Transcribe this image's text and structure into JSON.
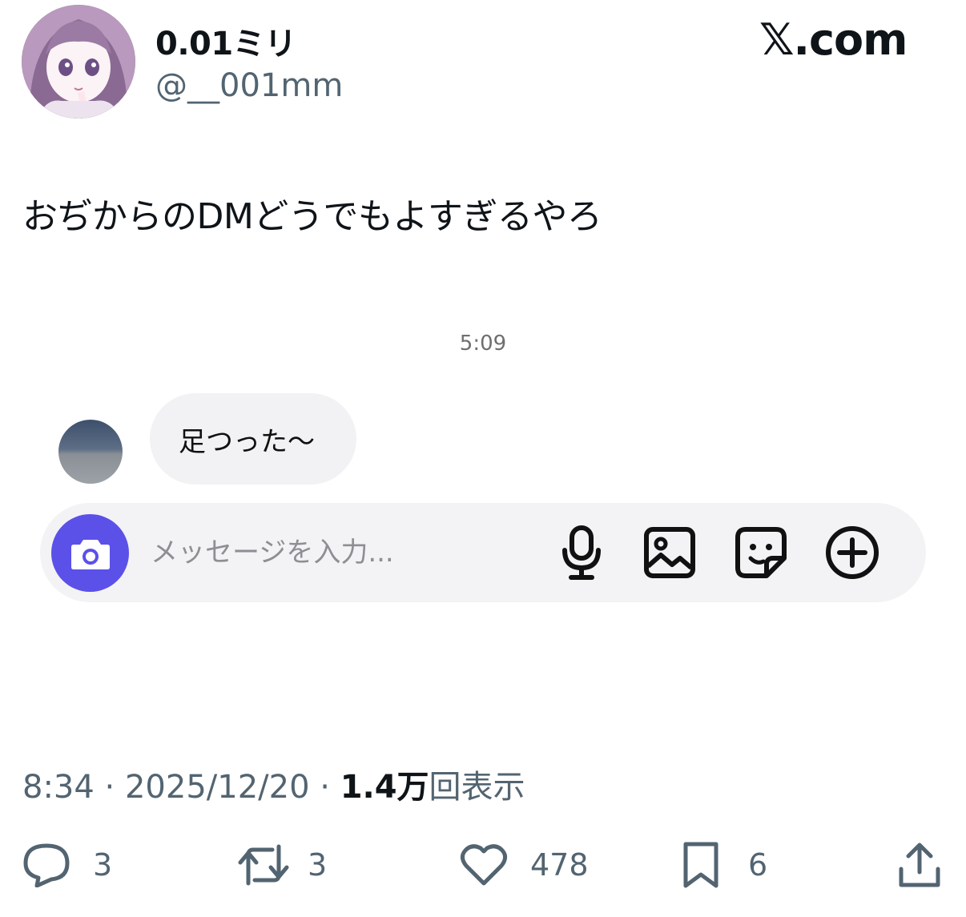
{
  "author": {
    "display_name": "0.01ミリ",
    "handle": "@__001mm"
  },
  "brand": {
    "logo_text": "𝕏.com"
  },
  "tweet": {
    "text": "おぢからのDMどうでもよすぎるやろ"
  },
  "dm_screenshot": {
    "timestamp": "5:09",
    "message": "足つった〜",
    "composer": {
      "placeholder": "メッセージを入力...",
      "accent_color": "#5b51e8"
    }
  },
  "meta": {
    "time": "8:34",
    "date": "2025/12/20",
    "separator": "·",
    "views_count": "1.4万",
    "views_label": "回表示"
  },
  "actions": {
    "replies": "3",
    "reposts": "3",
    "likes": "478",
    "bookmarks": "6"
  },
  "icons": [
    "reply-icon",
    "repost-icon",
    "like-icon",
    "bookmark-icon",
    "share-icon",
    "camera-icon",
    "microphone-icon",
    "image-icon",
    "sticker-icon",
    "plus-circle-icon"
  ]
}
